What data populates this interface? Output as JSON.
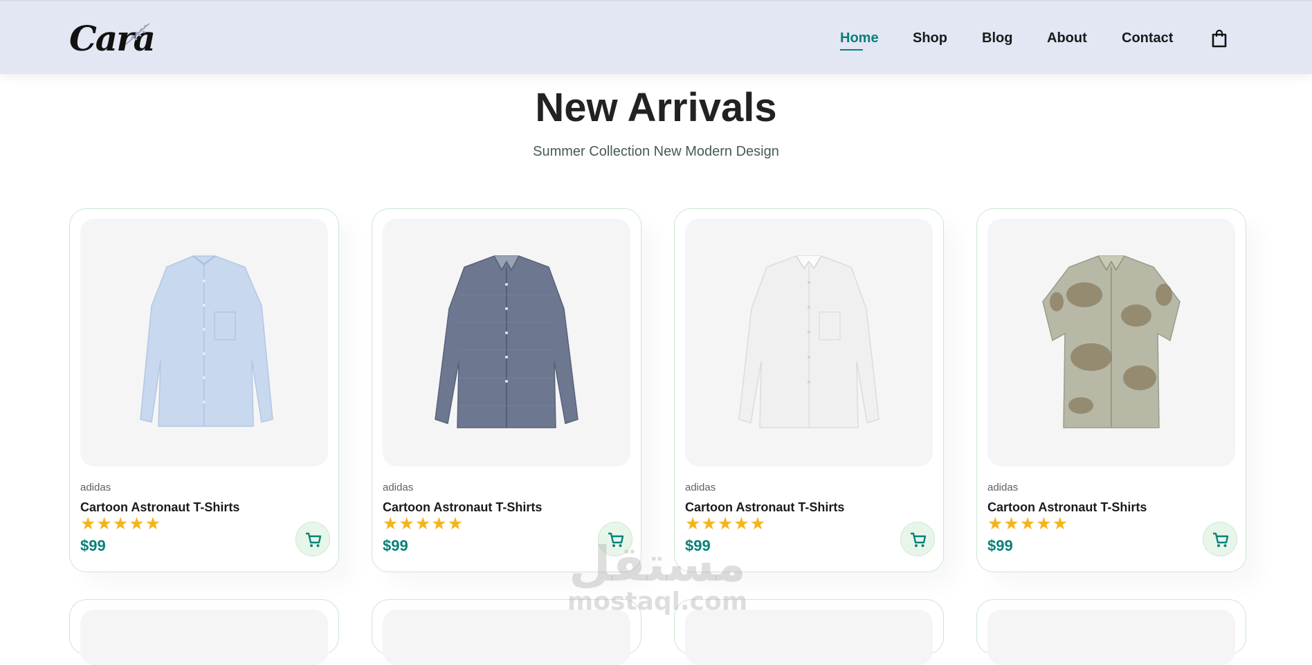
{
  "header": {
    "logo_text": "Cara",
    "nav": [
      {
        "label": "Home",
        "active": true
      },
      {
        "label": "Shop",
        "active": false
      },
      {
        "label": "Blog",
        "active": false
      },
      {
        "label": "About",
        "active": false
      },
      {
        "label": "Contact",
        "active": false
      }
    ],
    "bag_icon": "shopping-bag-icon"
  },
  "section": {
    "title": "New Arrivals",
    "subtitle": "Summer Collection New Modern Design"
  },
  "products": [
    {
      "brand": "adidas",
      "name": "Cartoon Astronaut T-Shirts",
      "rating": 5,
      "price": "$99",
      "image": "light-blue-shirt"
    },
    {
      "brand": "adidas",
      "name": "Cartoon Astronaut T-Shirts",
      "rating": 5,
      "price": "$99",
      "image": "navy-check-shirt"
    },
    {
      "brand": "adidas",
      "name": "Cartoon Astronaut T-Shirts",
      "rating": 5,
      "price": "$99",
      "image": "white-shirt"
    },
    {
      "brand": "adidas",
      "name": "Cartoon Astronaut T-Shirts",
      "rating": 5,
      "price": "$99",
      "image": "floral-short-sleeve-shirt"
    }
  ],
  "watermark": {
    "arabic": "مستقل",
    "latin": "mostaql.com"
  },
  "colors": {
    "accent": "#088178",
    "header_bg": "#e3e6f3",
    "star": "#f3b519",
    "card_border": "#cce7d0"
  }
}
